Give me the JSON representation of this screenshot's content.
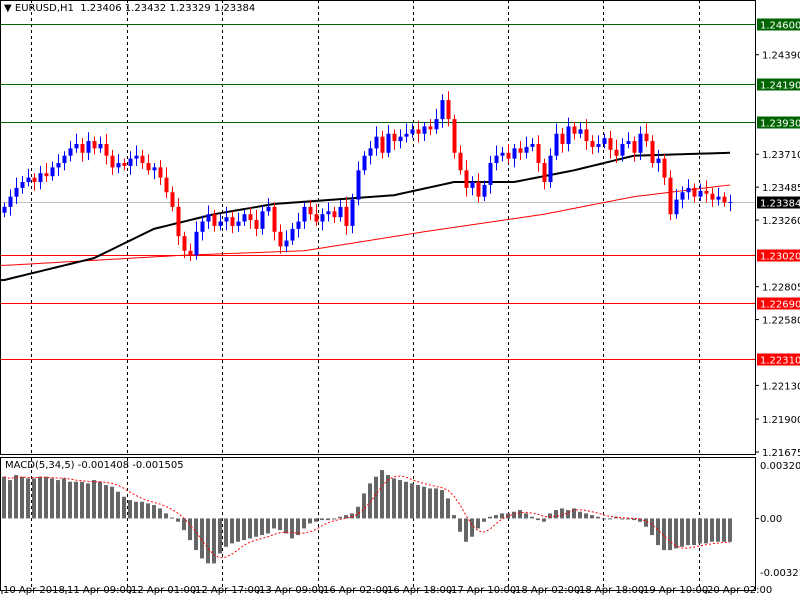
{
  "header": {
    "symbol": "EURUSD,H1",
    "ohlc": "1.23406 1.23432 1.23329 1.23384"
  },
  "macd": {
    "label": "MACD(5,34,5)",
    "values": "-0.001408 -0.001505",
    "axis": [
      "0.003204",
      "0.00",
      "-0.003214"
    ]
  },
  "colors": {
    "bull": "#0000ff",
    "bear": "#ff0000",
    "support": "#ff0000",
    "resistance": "#006400",
    "ma_fast": "#000000",
    "ma_slow": "#ff0000",
    "hist": "#666666"
  },
  "chart_data": {
    "type": "candlestick",
    "title": "EURUSD,H1",
    "ylim": [
      1.21675,
      1.246
    ],
    "price_ticks": [
      "1.24390",
      "1.23710",
      "1.23485",
      "1.23260",
      "1.22805",
      "1.22580",
      "1.22130",
      "1.21900",
      "1.21675"
    ],
    "levels": [
      {
        "label": "1.24600",
        "value": 1.246,
        "kind": "resistance"
      },
      {
        "label": "1.24190",
        "value": 1.2419,
        "kind": "resistance"
      },
      {
        "label": "1.23930",
        "value": 1.2393,
        "kind": "resistance"
      },
      {
        "label": "1.23384",
        "value": 1.23384,
        "kind": "current"
      },
      {
        "label": "1.23020",
        "value": 1.2302,
        "kind": "support"
      },
      {
        "label": "1.22690",
        "value": 1.2269,
        "kind": "support"
      },
      {
        "label": "1.22310",
        "value": 1.2231,
        "kind": "support"
      }
    ],
    "time_labels": [
      "10 Apr 2018",
      "11 Apr 09:00",
      "12 Apr 01:00",
      "12 Apr 17:00",
      "13 Apr 09:00",
      "16 Apr 02:00",
      "16 Apr 18:00",
      "17 Apr 10:00",
      "18 Apr 02:00",
      "18 Apr 18:00",
      "19 Apr 10:00",
      "20 Apr 02:00"
    ],
    "closes": [
      1.2335,
      1.2342,
      1.2348,
      1.2352,
      1.2355,
      1.2352,
      1.2358,
      1.2356,
      1.2362,
      1.2365,
      1.237,
      1.2375,
      1.2378,
      1.2372,
      1.238,
      1.2375,
      1.2378,
      1.237,
      1.2362,
      1.2365,
      1.2363,
      1.2368,
      1.237,
      1.2365,
      1.236,
      1.2362,
      1.2355,
      1.2345,
      1.2335,
      1.2315,
      1.2305,
      1.2302,
      1.2318,
      1.2325,
      1.233,
      1.2322,
      1.2325,
      1.2328,
      1.2322,
      1.2325,
      1.233,
      1.2326,
      1.232,
      1.2332,
      1.2335,
      1.2318,
      1.2308,
      1.2312,
      1.232,
      1.2325,
      1.2335,
      1.233,
      1.2325,
      1.233,
      1.2332,
      1.2328,
      1.2335,
      1.2322,
      1.234,
      1.236,
      1.237,
      1.2375,
      1.2383,
      1.2372,
      1.2385,
      1.238,
      1.2383,
      1.2385,
      1.2388,
      1.2385,
      1.239,
      1.2388,
      1.2395,
      1.2408,
      1.2395,
      1.2372,
      1.236,
      1.2348,
      1.2352,
      1.2342,
      1.235,
      1.2365,
      1.237,
      1.2372,
      1.2368,
      1.2375,
      1.2372,
      1.2376,
      1.2378,
      1.2365,
      1.2352,
      1.237,
      1.2385,
      1.2378,
      1.239,
      1.2385,
      1.2388,
      1.238,
      1.2376,
      1.2378,
      1.2382,
      1.2374,
      1.237,
      1.2378,
      1.238,
      1.2372,
      1.2385,
      1.238,
      1.2365,
      1.2368,
      1.2355,
      1.233,
      1.234,
      1.2345,
      1.2348,
      1.2342,
      1.2346,
      1.2344,
      1.234,
      1.2342,
      1.2338,
      1.23384
    ],
    "ma_fast": [
      [
        0,
        1.2285
      ],
      [
        15,
        1.23
      ],
      [
        25,
        1.232
      ],
      [
        35,
        1.233
      ],
      [
        45,
        1.2337
      ],
      [
        55,
        1.234
      ],
      [
        65,
        1.2343
      ],
      [
        75,
        1.2352
      ],
      [
        85,
        1.2352
      ],
      [
        95,
        1.236
      ],
      [
        105,
        1.237
      ],
      [
        121,
        1.2372
      ]
    ],
    "ma_slow": [
      [
        0,
        1.2295
      ],
      [
        30,
        1.2302
      ],
      [
        50,
        1.2305
      ],
      [
        70,
        1.2318
      ],
      [
        90,
        1.233
      ],
      [
        105,
        1.2342
      ],
      [
        121,
        1.235
      ]
    ],
    "macd_hist_e3": [
      2.5,
      2.3,
      2.6,
      2.5,
      2.4,
      2.4,
      2.5,
      2.5,
      2.4,
      2.3,
      2.4,
      2.2,
      2.2,
      2.2,
      2.1,
      2.3,
      2.2,
      2.0,
      1.9,
      1.6,
      1.3,
      1.1,
      1.0,
      1.0,
      0.9,
      0.8,
      0.6,
      0.3,
      0.05,
      -0.2,
      -0.7,
      -1.3,
      -1.9,
      -2.4,
      -2.7,
      -2.7,
      -2.1,
      -1.7,
      -1.5,
      -1.4,
      -1.3,
      -1.2,
      -1.1,
      -1.0,
      -0.9,
      -0.6,
      -0.7,
      -0.9,
      -1.2,
      -1.0,
      -0.6,
      -0.3,
      -0.2,
      -0.1,
      -0.1,
      0.0,
      0.1,
      0.2,
      0.3,
      0.7,
      1.5,
      2.1,
      2.5,
      2.9,
      2.6,
      2.4,
      2.3,
      2.2,
      2.1,
      2.0,
      1.9,
      1.8,
      1.8,
      1.7,
      1.2,
      0.2,
      -0.8,
      -1.4,
      -1.1,
      -0.6,
      -0.2,
      0.1,
      0.2,
      0.3,
      0.3,
      0.4,
      0.5,
      0.3,
      0.1,
      -0.1,
      -0.2,
      0.3,
      0.5,
      0.6,
      0.5,
      0.6,
      0.4,
      0.3,
      0.2,
      0.1,
      0.0,
      0.0,
      0.1,
      0.0,
      0.0,
      -0.1,
      -0.2,
      -0.5,
      -1.0,
      -1.6,
      -1.9,
      -1.9,
      -1.8,
      -1.7,
      -1.6,
      -1.6,
      -1.5,
      -1.5,
      -1.4,
      -1.4,
      -1.4,
      -1.4
    ],
    "macd_ylim_e3": [
      -3.214,
      3.204
    ]
  }
}
